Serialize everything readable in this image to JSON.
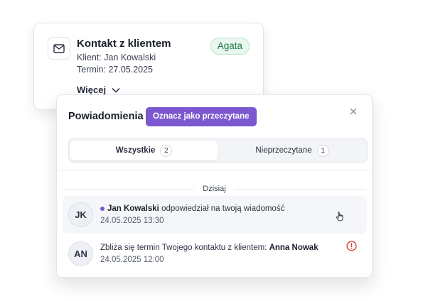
{
  "task_card": {
    "title": "Kontakt z klientem",
    "client": "Klient: Jan Kowalski",
    "date": "Termin: 27.05.2025",
    "badge": "Agata",
    "more": "Więcej",
    "icon": "mail-icon"
  },
  "panel": {
    "title": "Powiadomienia",
    "mark_read_label": "Oznacz jako przeczytane",
    "tabs": [
      {
        "label": "Wszystkie",
        "count": "2",
        "active": true
      },
      {
        "label": "Nieprzeczytane",
        "count": "1",
        "active": false
      }
    ],
    "day_label": "Dzisiaj",
    "notifications": [
      {
        "initials": "JK",
        "author": "Jan Kowalski",
        "message": "odpowiedział na twoją wiadomość",
        "time": "24.05.2025 13:30",
        "unread": true
      },
      {
        "initials": "AN",
        "message": "Zbliża się termin Twojego kontaktu z klientem:",
        "client": "Anna Nowak",
        "time": "24.05.2025 12:00",
        "unread": false
      }
    ]
  },
  "colors": {
    "accent": "#7b58cf",
    "badge_bg": "#e9f7ef",
    "badge_text": "#1f7a48",
    "alert": "#d9403a"
  }
}
